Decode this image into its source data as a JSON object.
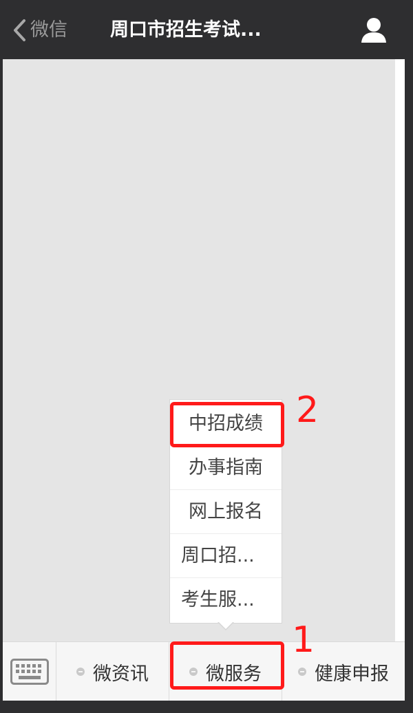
{
  "header": {
    "back_label": "微信",
    "title": "周口市招生考试..."
  },
  "bottom_menu": {
    "tabs": [
      {
        "label": "微资讯"
      },
      {
        "label": "微服务"
      },
      {
        "label": "健康申报"
      }
    ]
  },
  "submenu": {
    "items": [
      {
        "label": "中招成绩"
      },
      {
        "label": "办事指南"
      },
      {
        "label": "网上报名"
      },
      {
        "label": "周口招..."
      },
      {
        "label": "考生服..."
      }
    ]
  },
  "annotations": {
    "step1": "1",
    "step2": "2"
  },
  "colors": {
    "titlebar": "#2e2e30",
    "content_bg": "#e5e5e5",
    "annotation": "#ff1a1a"
  }
}
